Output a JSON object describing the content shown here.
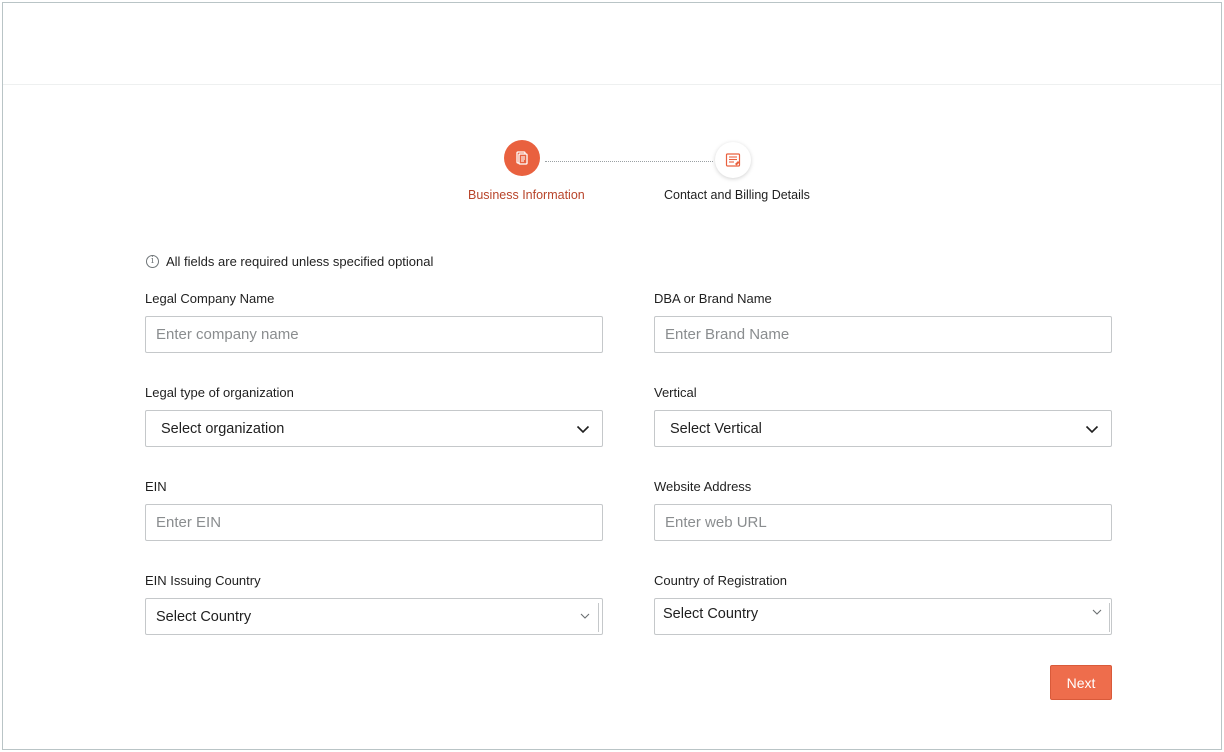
{
  "stepper": {
    "steps": [
      {
        "label": "Business Information",
        "state": "active"
      },
      {
        "label": "Contact and Billing Details",
        "state": "pending"
      }
    ]
  },
  "notice": {
    "text": "All fields are required unless specified optional"
  },
  "form": {
    "legal_company_name": {
      "label": "Legal Company Name",
      "placeholder": "Enter company name"
    },
    "dba_brand_name": {
      "label": "DBA or Brand Name",
      "placeholder": "Enter Brand Name"
    },
    "legal_type": {
      "label": "Legal type of organization",
      "value": "Select organization"
    },
    "vertical": {
      "label": "Vertical",
      "value": "Select Vertical"
    },
    "ein": {
      "label": "EIN",
      "placeholder": "Enter EIN"
    },
    "website": {
      "label": "Website Address",
      "placeholder": "Enter web URL"
    },
    "ein_country": {
      "label": "EIN Issuing Country",
      "value": "Select Country"
    },
    "registration_country": {
      "label": "Country of Registration",
      "value": "Select Country"
    }
  },
  "actions": {
    "next_label": "Next"
  },
  "colors": {
    "accent": "#e9613f",
    "button": "#ee6d4c",
    "active_step_text": "#b8442a"
  }
}
